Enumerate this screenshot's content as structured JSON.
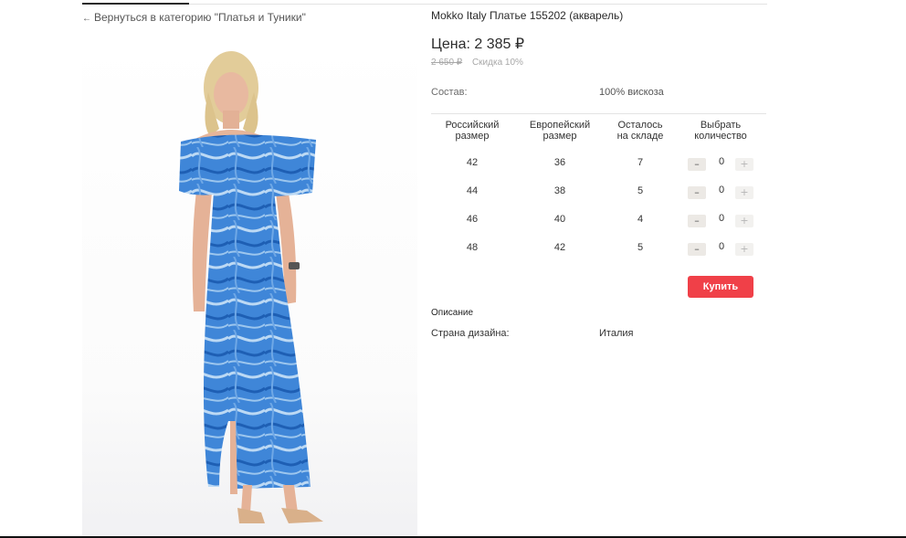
{
  "nav": {
    "back_arrow": "←",
    "back_label": "Вернуться в категорию \"Платья и Туники\""
  },
  "product": {
    "title": "Mokko Italy Платье 155202 (акварель)",
    "price_label": "Цена:",
    "price": "2 385 ₽",
    "old_price": "2 650 ₽",
    "discount": "Скидка 10%",
    "composition_label": "Состав:",
    "composition_value": "100% вискоза",
    "image_alt": "model-wearing-blue-watercolor-dress"
  },
  "table": {
    "headers": [
      "Российский\nразмер",
      "Европейский\nразмер",
      "Осталось\nна складе",
      "Выбрать\nколичество"
    ],
    "rows": [
      {
        "ru": "42",
        "eu": "36",
        "stock": "7",
        "qty": "0"
      },
      {
        "ru": "44",
        "eu": "38",
        "stock": "5",
        "qty": "0"
      },
      {
        "ru": "46",
        "eu": "40",
        "stock": "4",
        "qty": "0"
      },
      {
        "ru": "48",
        "eu": "42",
        "stock": "5",
        "qty": "0"
      }
    ],
    "minus_glyph": "–",
    "plus_glyph": "+"
  },
  "buy_button": "Купить",
  "description": {
    "label": "Описание",
    "country_label": "Страна дизайна:",
    "country_value": "Италия"
  },
  "colors": {
    "buy": "#f04048",
    "dress_blue": "#3f86d8"
  }
}
